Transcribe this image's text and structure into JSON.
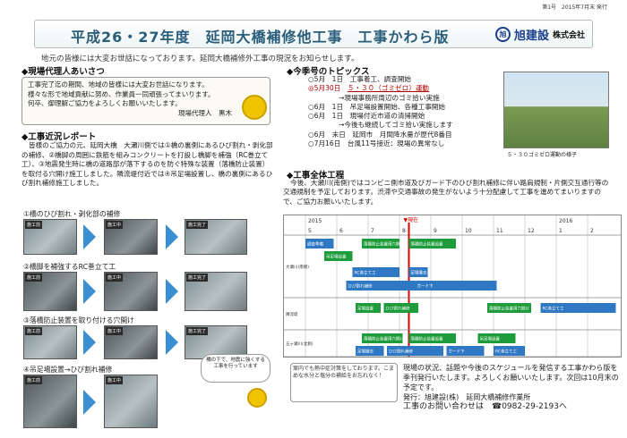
{
  "issue": {
    "text": "第1号　2015年7月末 発行"
  },
  "banner": {
    "title": "平成26・27年度　延岡大橋補修他工事　工事かわら版",
    "logo_mark": "旭",
    "logo_name": "旭建設",
    "logo_suffix": "株式会社"
  },
  "intro": "地元の皆様には大変お世話になっております。延岡大橋補修外工事の現況をお知らせします。",
  "greeting": {
    "heading": "◆現場代理人あいさつ",
    "lines": [
      "工事完了迄の期間、地域の皆様には大変お世話になります。",
      "様々な形で地域貢献に努め、作業員一同頑張ってまいります。",
      "何卒、御理解ご協力をよろしくお願いいたします。"
    ],
    "signature": "現場代理人　黒木"
  },
  "report": {
    "heading": "◆工事近況レポート",
    "body": "皆様のご協力の元、延岡大橋　大瀬川側では①橋の裏側にあるひび割れ・剥化部の補修、②橋脚の周囲に鉄筋を組みコンクリートを打設し橋脚を補強（RC巻立て工）、③地震発生時に橋の道路部が落下するのを防ぐ特殊な装置（落橋防止装置）を取付る穴開け施工しました。隣流堤付近では④吊足場設置し、橋の裏側にあるひび割れ補修施工しました。"
  },
  "photos": {
    "items": [
      "①橋のひび割れ・剥化部の補修",
      "②橋脚を補強するRC巻立て工",
      "③落橋防止装置を取り付ける穴開け",
      "④吊足場設置→ひび割れ補修"
    ],
    "labels": [
      "施工前",
      "施工中",
      "施工完了"
    ],
    "bubble": "橋の下で、地震に強くする工事を行っています"
  },
  "topics": {
    "heading": "◆今季号のトピックス",
    "rows": [
      {
        "date": "○5月　1日",
        "text": "工事着工、調査開始",
        "hl": false
      },
      {
        "date": "◎5月30日",
        "text": "５・３０（ゴミゼロ）運動",
        "hl": true
      },
      {
        "date": "",
        "text": "→現場事務所周辺のゴミ拾い実施",
        "hl": false
      },
      {
        "date": "○6月　1日",
        "text": "吊足場設置開始、各種工事開始",
        "hl": false
      },
      {
        "date": "○6月　1日",
        "text": "現場付近市道の清掃開始",
        "hl": false
      },
      {
        "date": "",
        "text": "→今後も継続してゴミ拾い実施します",
        "hl": false
      },
      {
        "date": "○6月　末日",
        "text": "延岡市　月間降水量が歴代8番目",
        "hl": false
      },
      {
        "date": "○7月16日",
        "text": "台風11号接近：現場の異常なし",
        "hl": false
      }
    ],
    "caption": "５・３０ゴミゼロ運動の様子"
  },
  "plan": {
    "heading": "◆工事全体工程",
    "body": "今後、大瀬川(南側)ではコンビニ側市道及びガード下のひび割れ補修に伴い路肩規制・片側交互通行等の交通規制を予定しております。渋滞や交通事故の発生がないよう十分配慮して工事を進めてまいりますので、ご協力お願いいたします。"
  },
  "chart_data": {
    "type": "table",
    "years": [
      "2015",
      "2016"
    ],
    "months": [
      "5",
      "6",
      "7",
      "8",
      "9",
      "10",
      "11",
      "12",
      "1",
      "2"
    ],
    "today_label": "▼現在",
    "rows": [
      "大瀬川(南側)",
      "隣流堤",
      "五ヶ瀬川(北側)"
    ],
    "tasks": [
      "調査準備",
      "落橋防止装置用穴開け",
      "落橋防止装置設置",
      "吊足場設置",
      "RC巻立て工",
      "足場撤去",
      "ひび割れ補修",
      "ガード下",
      "足場設置",
      "ひび割れ補修",
      "足場撤去",
      "落橋防止装置用穴開け",
      "RC巻立て工",
      "落橋防止装置用穴開け",
      "落橋防止装置設置",
      "吊足場設置",
      "RC巻立て工",
      "足場撤去",
      "ひび割れ補修",
      "ガード下"
    ]
  },
  "note": "案内でも熱中症対策をしております。こまめな水分と塩分の補給をお忘れなく！",
  "footer": {
    "lines": [
      "現場の状況、話題や今後のスケジュールを発信する工事かわら版を季刊発行いたします。よろしくお願いいたします。次回は10月末の予定です。",
      "発行：旭建設(株)　延岡大橋補修作業所",
      "工事のお問い合わせは　☎0982-29-2193へ"
    ]
  }
}
